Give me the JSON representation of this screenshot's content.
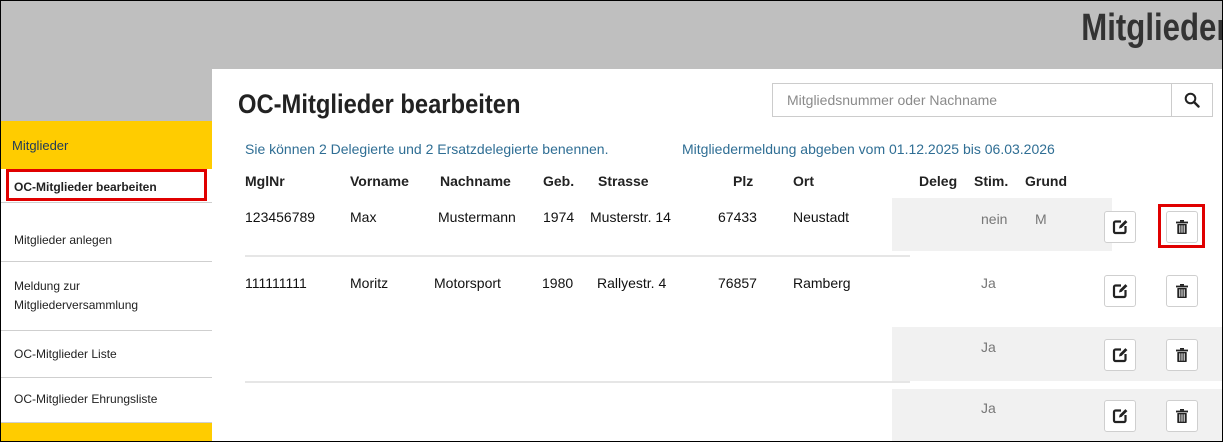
{
  "header": {
    "title": "Mitglieder"
  },
  "sidebar": {
    "section_label": "Mitglieder",
    "items": [
      {
        "label": "OC-Mitglieder bearbeiten"
      },
      {
        "label": "Mitglieder anlegen"
      },
      {
        "label": "Meldung zur Mitgliederversammlung"
      },
      {
        "label": "OC-Mitglieder Liste"
      },
      {
        "label": "OC-Mitglieder Ehrungsliste"
      }
    ]
  },
  "main": {
    "title": "OC-Mitglieder bearbeiten",
    "search": {
      "placeholder": "Mitgliedsnummer oder Nachname",
      "icon": "search-icon"
    },
    "info_delegates": "Sie können 2 Delegierte und 2 Ersatzdelegierte benennen.",
    "info_period": "Mitgliedermeldung abgeben vom 01.12.2025 bis 06.03.2026"
  },
  "table": {
    "columns": [
      "MglNr",
      "Vorname",
      "Nachname",
      "Geb.",
      "Strasse",
      "Plz",
      "Ort",
      "Deleg",
      "Stim.",
      "Grund"
    ],
    "rows": [
      {
        "mglnr": "123456789",
        "vorname": "Max",
        "nachname": "Mustermann",
        "geb": "1974",
        "strasse": "Musterstr. 14",
        "plz": "67433",
        "ort": "Neustadt",
        "deleg": "",
        "stim": "nein",
        "grund": "M"
      },
      {
        "mglnr": "111111111",
        "vorname": "Moritz",
        "nachname": "Motorsport",
        "geb": "1980",
        "strasse": "Rallyestr. 4",
        "plz": "76857",
        "ort": "Ramberg",
        "deleg": "",
        "stim": "Ja",
        "grund": ""
      },
      {
        "mglnr": "",
        "vorname": "",
        "nachname": "",
        "geb": "",
        "strasse": "",
        "plz": "",
        "ort": "",
        "deleg": "",
        "stim": "Ja",
        "grund": ""
      },
      {
        "mglnr": "",
        "vorname": "",
        "nachname": "",
        "geb": "",
        "strasse": "",
        "plz": "",
        "ort": "",
        "deleg": "",
        "stim": "Ja",
        "grund": ""
      }
    ],
    "row_actions": {
      "edit_icon": "edit-icon",
      "delete_icon": "trash-icon"
    }
  },
  "colors": {
    "accent": "#ffcc00",
    "header_gray": "#bfbfbf",
    "info_text": "#2f6e94",
    "highlight": "#e00000"
  }
}
